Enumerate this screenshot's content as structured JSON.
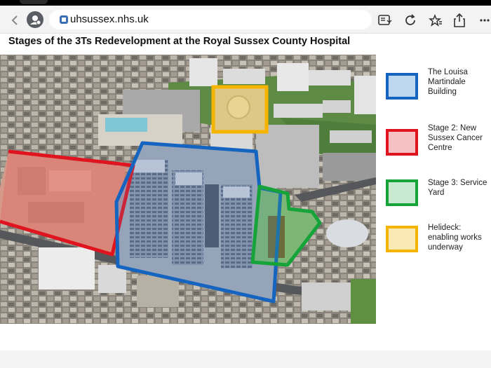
{
  "browser": {
    "url": "uhsussex.nhs.uk",
    "icons": [
      "chevron-left-icon",
      "profile-icon",
      "site-icon",
      "reader-mode-icon",
      "reload-icon",
      "favorites-icon",
      "share-icon",
      "more-icon"
    ]
  },
  "page": {
    "title": "Stages of the 3Ts Redevelopment at the Royal Sussex County Hospital"
  },
  "legend": [
    {
      "label": "The Louisa Martindale Building",
      "border": "#1565c0",
      "fill": "#bcd7ef"
    },
    {
      "label": "Stage 2: New Sussex Cancer Centre",
      "border": "#e0141e",
      "fill": "#f6c1c3"
    },
    {
      "label": "Stage 3: Service Yard",
      "border": "#15a33a",
      "fill": "#c7ead1"
    },
    {
      "label": "Helideck: enabling works underway",
      "border": "#f5b400",
      "fill": "#fbe9b3"
    }
  ]
}
